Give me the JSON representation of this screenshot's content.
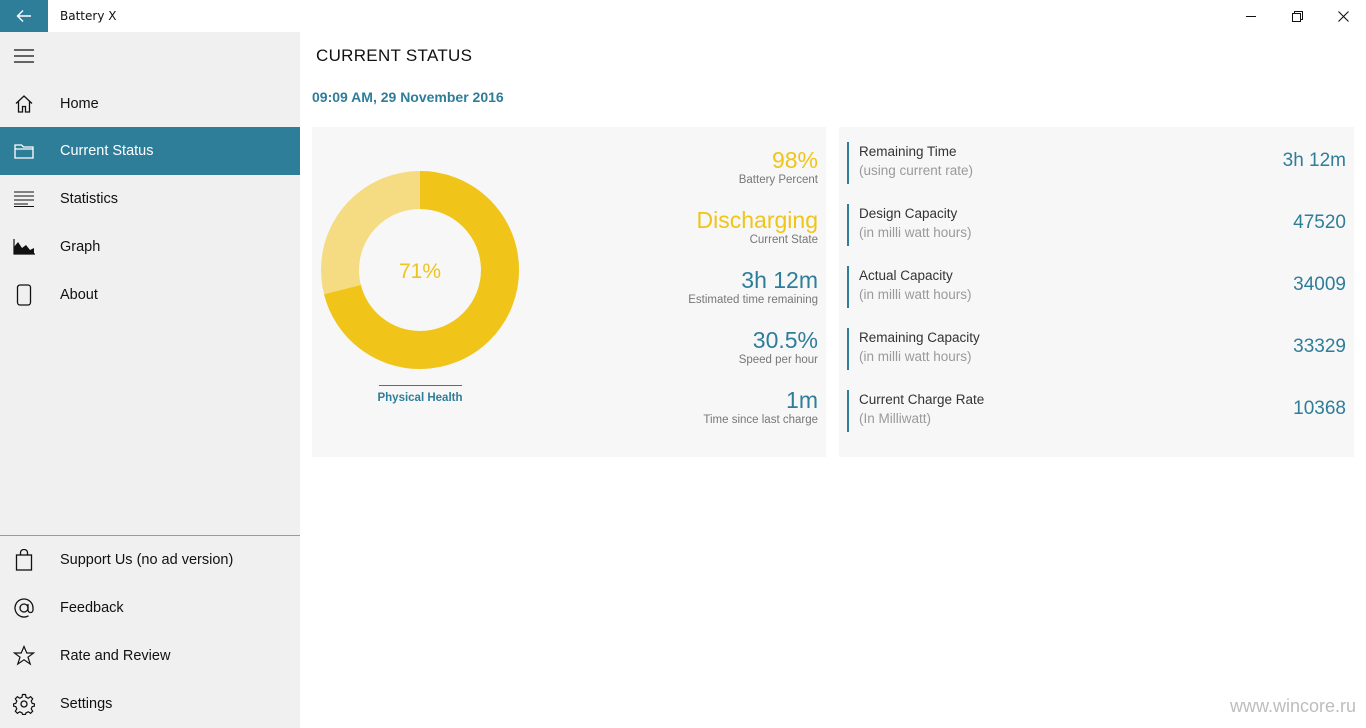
{
  "window": {
    "title": "Battery X",
    "back_icon": "arrow-left-icon",
    "controls": [
      "minimize-icon",
      "restore-icon",
      "close-icon"
    ]
  },
  "sidebar": {
    "menu_icon": "hamburger-icon",
    "items": [
      {
        "label": "Home",
        "icon": "home-icon"
      },
      {
        "label": "Current Status",
        "icon": "folder-icon",
        "active": true
      },
      {
        "label": "Statistics",
        "icon": "list-lines-icon"
      },
      {
        "label": "Graph",
        "icon": "area-chart-icon"
      },
      {
        "label": "About",
        "icon": "phone-icon"
      }
    ],
    "bottom_items": [
      {
        "label": "Support Us (no ad version)",
        "icon": "shopping-bag-icon"
      },
      {
        "label": "Feedback",
        "icon": "at-sign-icon"
      },
      {
        "label": "Rate and Review",
        "icon": "star-icon"
      },
      {
        "label": "Settings",
        "icon": "gear-icon"
      }
    ]
  },
  "main": {
    "title": "CURRENT STATUS",
    "timestamp": "09:09 AM, 29 November 2016",
    "health": {
      "percent_label": "71%",
      "value": 0.71,
      "label": "Physical Health"
    },
    "stats": [
      {
        "value": "98%",
        "label": "Battery Percent",
        "color": "yellow"
      },
      {
        "value": "Discharging",
        "label": "Current State",
        "color": "yellow"
      },
      {
        "value": "3h 12m",
        "label": "Estimated time remaining",
        "color": "teal"
      },
      {
        "value": "30.5%",
        "label": "Speed per hour",
        "color": "teal"
      },
      {
        "value": "1m",
        "label": "Time since last charge",
        "color": "teal"
      }
    ],
    "metrics": [
      {
        "name": "Remaining Time",
        "unit": "(using current rate)",
        "value": "3h 12m"
      },
      {
        "name": "Design Capacity",
        "unit": "(in milli watt hours)",
        "value": "47520"
      },
      {
        "name": "Actual Capacity",
        "unit": "(in milli watt hours)",
        "value": "34009"
      },
      {
        "name": "Remaining Capacity",
        "unit": "(in milli watt hours)",
        "value": "33329"
      },
      {
        "name": "Current Charge Rate",
        "unit": "(In Milliwatt)",
        "value": "10368"
      }
    ]
  },
  "watermark": "www.wincore.ru",
  "colors": {
    "accent": "#2e7d99",
    "yellow": "#f0c419",
    "yellow_light": "#f5dc83",
    "sidebar_bg": "#f0f0f0",
    "card_bg": "#f7f7f7"
  }
}
